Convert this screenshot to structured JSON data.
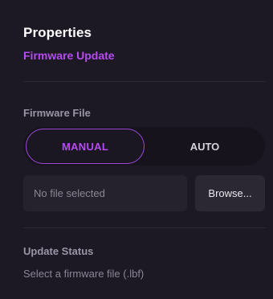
{
  "header": {
    "title": "Properties",
    "subtitle": "Firmware Update"
  },
  "firmware_file": {
    "label": "Firmware File",
    "mode_options": [
      "MANUAL",
      "AUTO"
    ],
    "selected_mode": "MANUAL",
    "file_field_text": "No file selected",
    "browse_label": "Browse..."
  },
  "update_status": {
    "label": "Update Status",
    "message": "Select a firmware file (.lbf)"
  },
  "colors": {
    "background": "#1c1924",
    "accent": "#b44cf0",
    "accent_border": "#9b48d6"
  }
}
